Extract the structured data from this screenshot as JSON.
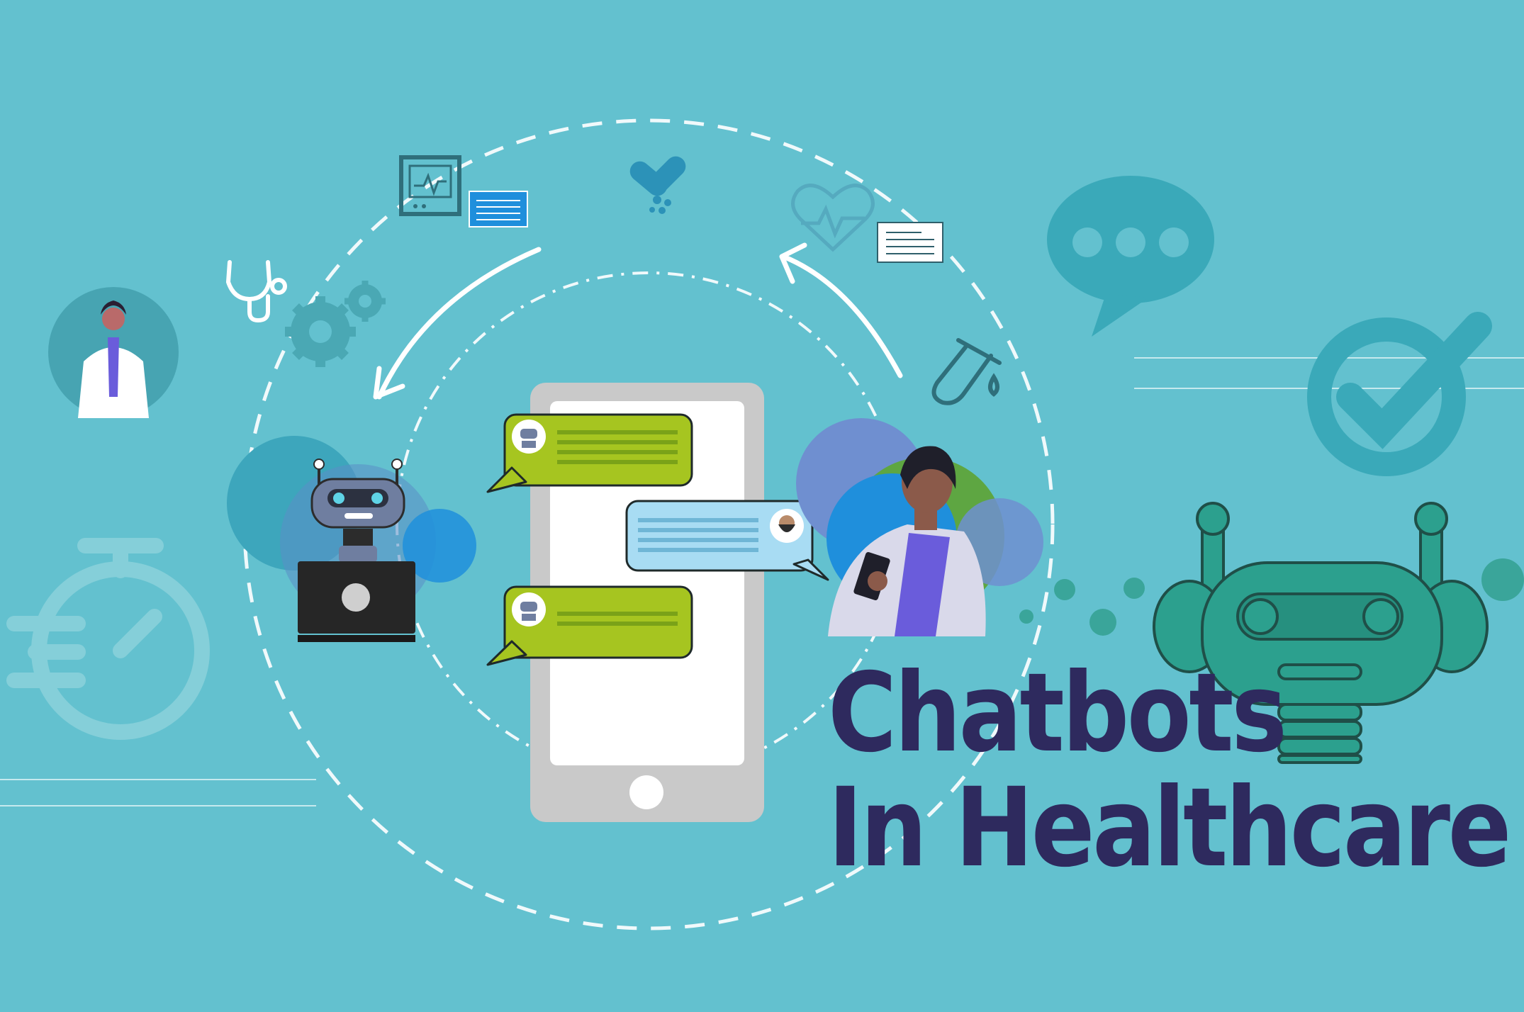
{
  "title": {
    "line1": "Chatbots",
    "line2": "In Healthcare"
  },
  "icons": [
    "doctor-avatar-icon",
    "stethoscope-icon",
    "gears-icon",
    "monitor-icon",
    "document-icon",
    "pills-icon",
    "heart-rate-icon",
    "prescription-icon",
    "test-tube-icon",
    "speech-bubble-icon",
    "checkmark-icon",
    "stopwatch-icon",
    "robot-laptop-icon",
    "smartphone-icon",
    "patient-icon",
    "robot-large-icon"
  ],
  "colors": {
    "background": "#63c1cf",
    "title": "#2e2a5e",
    "bot_bubble": "#a6c520",
    "user_bubble": "#a8dcf3",
    "robot_teal": "#2ca08e",
    "faded_icon": "#3faabb"
  }
}
